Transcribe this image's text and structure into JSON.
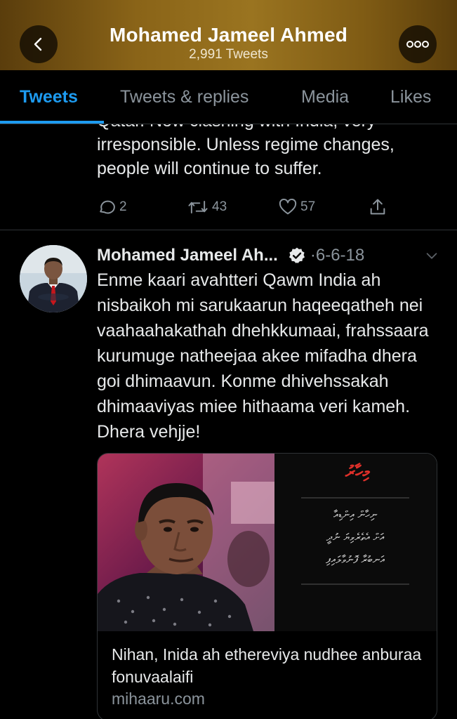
{
  "header": {
    "name": "Mohamed Jameel Ahmed",
    "tweet_count": "2,991 Tweets",
    "back_icon": "chevron-left-icon",
    "more_icon": "more-horizontal-icon"
  },
  "tabs": [
    {
      "label": "Tweets",
      "active": true
    },
    {
      "label": "Tweets & replies",
      "active": false
    },
    {
      "label": "Media",
      "active": false
    },
    {
      "label": "Likes",
      "active": false
    }
  ],
  "prev_tweet": {
    "text": "Qatar. Now clashing with India; very irresponsible. Unless regime changes, people will continue to suffer.",
    "replies": "2",
    "retweets": "43",
    "likes": "57"
  },
  "tweet": {
    "author": "Mohamed Jameel Ah...",
    "date": "6-6-18",
    "separator": "·",
    "text": "Enme kaari avahtteri Qawm India ah nisbaikoh mi sarukaarun haqeeqatheh nei vaahaahakathah dhehkkumaai, frahssaara kurumuge natheejaa akee mifadha dhera goi dhimaavun. Konme dhivehssakah dhimaaviyas miee hithaama veri kameh. Dhera vehjje!",
    "card": {
      "title": "Nihan, Inida ah ethereviya nudhee anburaa fonuvaalaifi",
      "domain": "mihaaru.com",
      "logo_text": "މިހާރު",
      "quote_lines": [
        "ނިހާން އިންޑިއާ",
        "އަށް އެތެރެވިޔަ ނުދީ",
        "އަނބުރާ ފޮނުވާލައިފި"
      ]
    }
  },
  "colors": {
    "accent": "#1d9bf0",
    "muted": "#8b949c",
    "header_gold": "#8a6418",
    "logo_red": "#e0302a"
  }
}
